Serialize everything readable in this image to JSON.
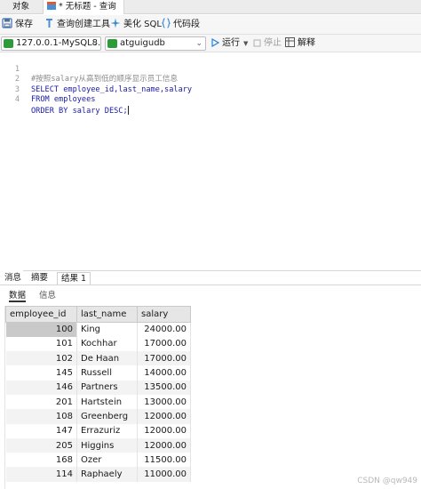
{
  "tabs": {
    "objects": "对象",
    "query": "* 无标题 - 查询"
  },
  "toolbar": {
    "save": "保存",
    "query_builder": "查询创建工具",
    "beautify": "美化 SQL",
    "snippet": "代码段"
  },
  "connection": {
    "server": "127.0.0.1-MySQL8.0",
    "database": "atguigudb",
    "run": "运行",
    "stop": "停止",
    "explain": "解释"
  },
  "editor": {
    "lines": [
      {
        "no": "1",
        "text": "#按照salary从高到低的顺序显示员工信息"
      },
      {
        "no": "2",
        "text": "SELECT employee_id,last_name,salary"
      },
      {
        "no": "3",
        "text": "FROM employees"
      },
      {
        "no": "4",
        "text": "ORDER BY salary DESC;"
      }
    ]
  },
  "results": {
    "tabs": [
      "消息",
      "摘要",
      "结果 1"
    ],
    "subtabs": [
      "数据",
      "信息"
    ],
    "columns": [
      "employee_id",
      "last_name",
      "salary"
    ],
    "rows": [
      [
        "100",
        "King",
        "24000.00"
      ],
      [
        "101",
        "Kochhar",
        "17000.00"
      ],
      [
        "102",
        "De Haan",
        "17000.00"
      ],
      [
        "145",
        "Russell",
        "14000.00"
      ],
      [
        "146",
        "Partners",
        "13500.00"
      ],
      [
        "201",
        "Hartstein",
        "13000.00"
      ],
      [
        "108",
        "Greenberg",
        "12000.00"
      ],
      [
        "147",
        "Errazuriz",
        "12000.00"
      ],
      [
        "205",
        "Higgins",
        "12000.00"
      ],
      [
        "168",
        "Ozer",
        "11500.00"
      ],
      [
        "114",
        "Raphaely",
        "11000.00"
      ]
    ]
  },
  "watermark": "CSDN @qw949",
  "colors": {
    "keyword": "#1a1aa6",
    "comment": "#8a8a8a",
    "run_icon": "#2a7de1"
  }
}
